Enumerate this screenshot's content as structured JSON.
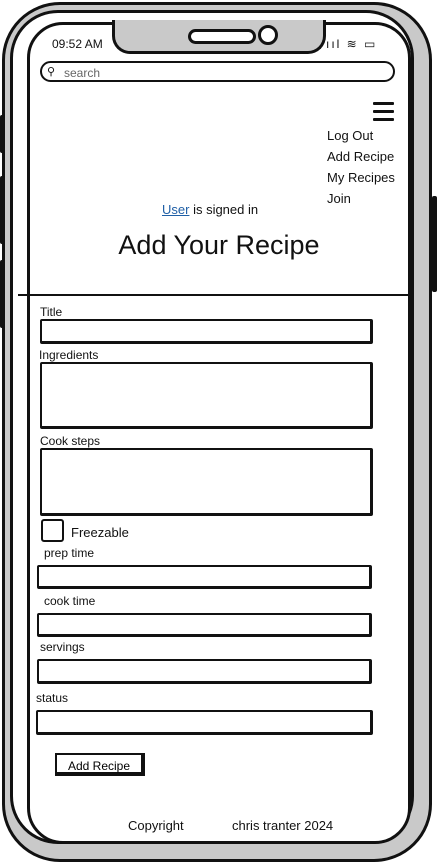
{
  "status_bar": {
    "time": "09:52 AM",
    "icons": "ııl ≋ ▭"
  },
  "search": {
    "placeholder": "search"
  },
  "nav": {
    "menu_items": [
      {
        "label": "Log Out"
      },
      {
        "label": "Add Recipe"
      },
      {
        "label": "My Recipes"
      },
      {
        "label": "Join"
      }
    ]
  },
  "session": {
    "user_link": "User",
    "signed_in_text": " is signed in"
  },
  "page": {
    "title": "Add Your Recipe"
  },
  "form": {
    "title_label": "Title",
    "ingredients_label": "Ingredients",
    "cook_steps_label": "Cook steps",
    "freezable_label": "Freezable",
    "prep_time_label": "prep time",
    "cook_time_label": "cook time",
    "servings_label": "servings",
    "status_label": "status",
    "submit_label": "Add Recipe"
  },
  "footer": {
    "copyright": "Copyright",
    "author": "chris tranter 2024"
  }
}
